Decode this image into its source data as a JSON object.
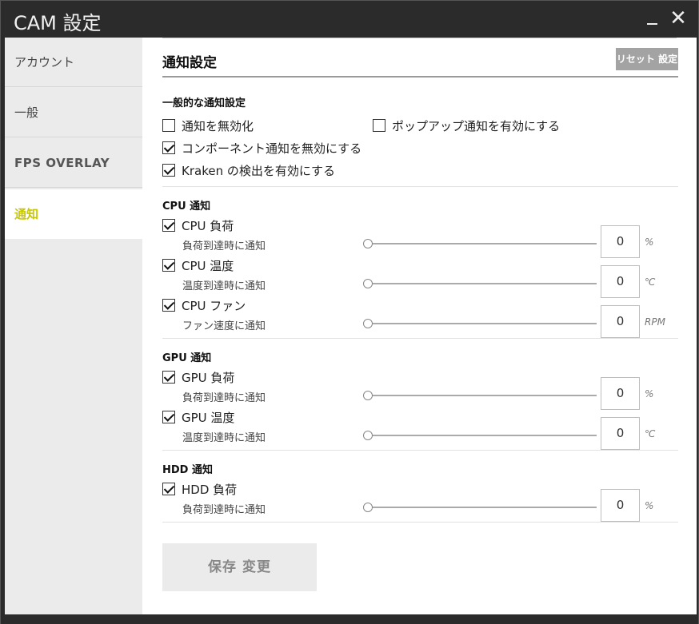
{
  "window": {
    "title": "CAM 設定"
  },
  "sidebar": {
    "items": [
      {
        "label": "アカウント"
      },
      {
        "label": "一般"
      },
      {
        "label": "FPS OVERLAY"
      },
      {
        "label": "通知"
      }
    ]
  },
  "main": {
    "title": "通知設定",
    "reset_label": "リセット 設定",
    "general": {
      "heading": "一般的な通知設定",
      "disable_notifications": {
        "label": "通知を無効化",
        "checked": false
      },
      "enable_popup": {
        "label": "ポップアップ通知を有効にする",
        "checked": false
      },
      "disable_component": {
        "label": "コンポーネント通知を無効にする",
        "checked": true
      },
      "enable_kraken": {
        "label": "Kraken の検出を有効にする",
        "checked": true
      }
    },
    "cpu": {
      "heading": "CPU 通知",
      "items": [
        {
          "label": "CPU 負荷",
          "checked": true,
          "sub": "負荷到達時に通知",
          "value": "0",
          "unit": "%"
        },
        {
          "label": "CPU 温度",
          "checked": true,
          "sub": "温度到達時に通知",
          "value": "0",
          "unit": "℃"
        },
        {
          "label": "CPU ファン",
          "checked": true,
          "sub": "ファン速度に通知",
          "value": "0",
          "unit": "RPM"
        }
      ]
    },
    "gpu": {
      "heading": "GPU 通知",
      "items": [
        {
          "label": "GPU 負荷",
          "checked": true,
          "sub": "負荷到達時に通知",
          "value": "0",
          "unit": "%"
        },
        {
          "label": "GPU 温度",
          "checked": true,
          "sub": "温度到達時に通知",
          "value": "0",
          "unit": "℃"
        }
      ]
    },
    "hdd": {
      "heading": "HDD 通知",
      "items": [
        {
          "label": "HDD 負荷",
          "checked": true,
          "sub": "負荷到達時に通知",
          "value": "0",
          "unit": "%"
        }
      ]
    },
    "save_label": "保存 変更"
  }
}
